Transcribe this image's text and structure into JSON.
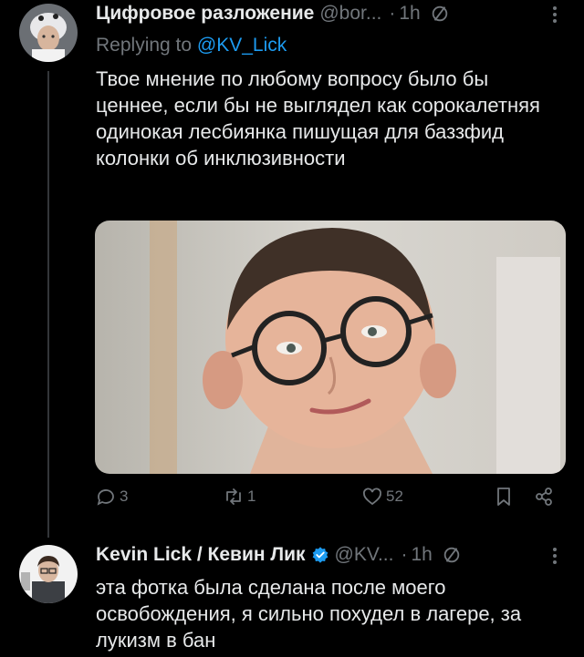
{
  "tweet1": {
    "display_name": "Цифровое разложение",
    "handle": "@bor...",
    "separator": "·",
    "time": "1h",
    "replying_prefix": "Replying to ",
    "replying_to": "@KV_Lick",
    "text": "Твое мнение по любому вопросу было бы ценнее, если бы не выглядел как сорокалетняя одинокая лесбиянка пишущая для баззфид колонки об инклюзивности",
    "replies": "3",
    "retweets": "1",
    "likes": "52"
  },
  "tweet2": {
    "display_name": "Kevin Lick / Кевин Лик",
    "handle": "@KV...",
    "separator": "·",
    "time": "1h",
    "text": "эта фотка была сделана после моего освобождения, я сильно похудел в лагере, за лукизм в бан"
  },
  "colors": {
    "background": "#000000",
    "text": "#e7e9ea",
    "secondary": "#71767b",
    "accent": "#1d9bf0"
  }
}
